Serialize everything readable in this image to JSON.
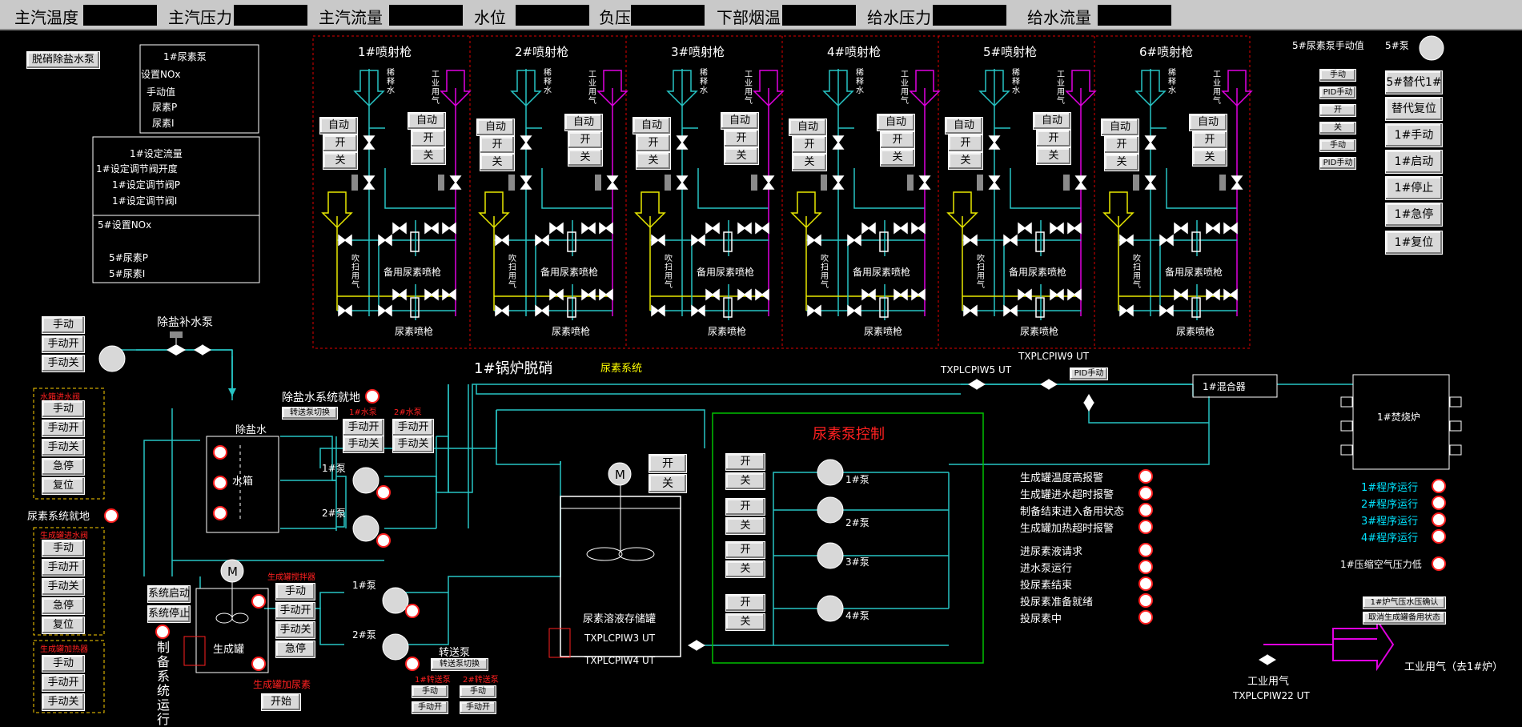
{
  "topbar": {
    "items": [
      {
        "label": "主汽温度"
      },
      {
        "label": "主汽压力"
      },
      {
        "label": "主汽流量"
      },
      {
        "label": "水位"
      },
      {
        "label": "负压"
      },
      {
        "label": "下部烟温"
      },
      {
        "label": "给水压力"
      },
      {
        "label": "给水流量"
      }
    ]
  },
  "left": {
    "demin_btn": "脱硝除盐水泵",
    "urea_pump_panel": {
      "title": "1#尿素泵",
      "lines": [
        "设置NOx",
        "手动值",
        "尿素P",
        "尿素I"
      ]
    },
    "flow_panel": {
      "lines": [
        "1#设定流量",
        "1#设定调节阀开度",
        "1#设定调节阀P",
        "1#设定调节阀I"
      ]
    },
    "nox5_panel": {
      "lines": [
        "5#设置NOx",
        "5#尿素P",
        "5#尿素I"
      ]
    },
    "manual_group": [
      "手动",
      "手动开",
      "手动关"
    ],
    "demin_pump_label": "除盐补水泵",
    "water_inlet_title": "水箱进水阀",
    "water_inlet_btns": [
      "手动",
      "手动开",
      "手动关",
      "急停",
      "复位"
    ],
    "urea_local": "尿素系统就地",
    "gen_inlet_title": "生成罐进水阀",
    "gen_inlet_btns": [
      "手动",
      "手动开",
      "手动关",
      "急停",
      "复位"
    ],
    "gen_heat_title": "生成罐加热器",
    "gen_heat_btns": [
      "手动",
      "手动开",
      "手动关"
    ]
  },
  "guns": {
    "items": [
      {
        "title": "1#喷射枪"
      },
      {
        "title": "2#喷射枪"
      },
      {
        "title": "3#喷射枪"
      },
      {
        "title": "4#喷射枪"
      },
      {
        "title": "5#喷射枪"
      },
      {
        "title": "6#喷射枪"
      }
    ],
    "auto": "自动",
    "open": "开",
    "close": "关",
    "dilute": "稀释水",
    "industrial_air": "工业用气",
    "purge": "吹扫用气",
    "spare_gun": "备用尿素喷枪",
    "urea_gun": "尿素喷枪"
  },
  "right_panel": {
    "manual_title": "5#尿素泵手动值",
    "pump5": "5#泵",
    "small_btns": [
      "手动",
      "PID手动",
      "开",
      "关",
      "手动",
      "PID手动"
    ],
    "big_btns": [
      "5#替代1#",
      "替代复位",
      "1#手动",
      "1#启动",
      "1#停止",
      "1#急停",
      "1#复位"
    ]
  },
  "system": {
    "boiler_title": "1#锅炉脱硝",
    "urea_system": "尿素系统",
    "demin_local": "除盐水系统就地",
    "transfer_switch": "转送泵切换",
    "pump1_red": "1#水泵",
    "pump2_red": "2#水泵",
    "manual_open": "手动开",
    "manual_close": "手动关",
    "demin_water": "除盐水",
    "water_tank": "水箱",
    "p1": "1#泵",
    "p2": "2#泵",
    "tag5": "TXPLCPIW5 UT",
    "tag9": "TXPLCPIW9 UT",
    "pid_manual": "PID手动",
    "mixer": "1#混合器",
    "incinerator": "1#焚烧炉",
    "motor": "M",
    "open": "开",
    "close": "关",
    "storage_tank": "尿素溶液存储罐",
    "tag3": "TXPLCPIW3 UT",
    "tag4": "TXPLCPIW4 UT",
    "urea_pump_ctrl": "尿素泵控制",
    "up1": "1#泵",
    "up2": "2#泵",
    "up3": "3#泵",
    "up4": "4#泵",
    "gen_tank": "生成罐",
    "gen_stirrer": "生成罐搅拌器",
    "stirrer_btns": [
      "手动",
      "手动开",
      "手动关",
      "急停"
    ],
    "sys_start": "系统启动",
    "sys_stop": "系统停止",
    "prep_text": "制备系统运行",
    "transfer_pump": "转送泵",
    "transfer_switch2": "转送泵切换",
    "tp1": "1#转送泵",
    "tp2": "2#转送泵",
    "tp_manual": "手动",
    "tp_manual_open": "手动开",
    "gen_add_urea": "生成罐加尿素",
    "start": "开始"
  },
  "alarms": {
    "items": [
      "生成罐温度高报警",
      "生成罐进水超时报警",
      "制备结束进入备用状态",
      "生成罐加热超时报警",
      "进尿素液请求",
      "进水泵运行",
      "投尿素结束",
      "投尿素准备就绪",
      "投尿素中"
    ]
  },
  "program": {
    "items": [
      "1#程序运行",
      "2#程序运行",
      "3#程序运行",
      "4#程序运行"
    ],
    "air_low": "1#压缩空气压力低",
    "confirm_btns": [
      "1#炉气压水压确认",
      "取消生成罐备用状态"
    ],
    "industrial_air": "工业用气",
    "tag22": "TXPLCPIW22 UT",
    "to_furnace": "工业用气（去1#炉）"
  },
  "colors": {
    "pipe": "#27c4c4",
    "alarm": "#ff2020",
    "magenta": "#e000e0",
    "yellow": "#e8e800",
    "green": "#00c000"
  }
}
